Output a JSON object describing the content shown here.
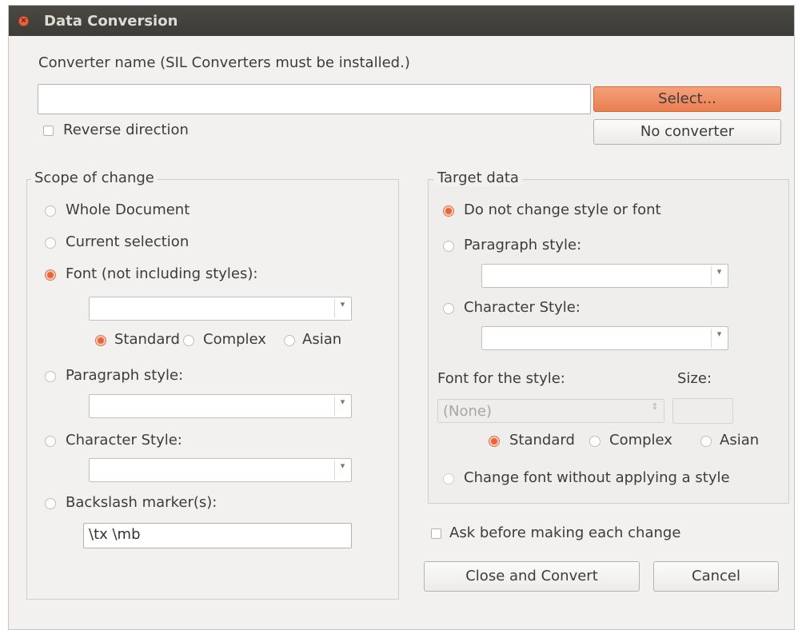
{
  "window": {
    "title": "Data Conversion"
  },
  "converter": {
    "label": "Converter name (SIL Converters must be installed.)",
    "name_value": "",
    "select_button": "Select...",
    "no_converter_button": "No converter",
    "reverse_direction": "Reverse direction"
  },
  "scope": {
    "title": "Scope of change",
    "whole_document": "Whole Document",
    "current_selection": "Current selection",
    "font": "Font (not including styles):",
    "font_value": "",
    "script_options": [
      "Standard",
      "Complex",
      "Asian"
    ],
    "paragraph_style": "Paragraph style:",
    "paragraph_value": "",
    "character_style": "Character Style:",
    "character_value": "",
    "backslash_markers": "Backslash marker(s):",
    "backslash_value": "\\tx \\mb"
  },
  "target": {
    "title": "Target data",
    "no_change": "Do not change style or font",
    "paragraph_style": "Paragraph style:",
    "character_style": "Character Style:",
    "font_for_style": "Font for the style:",
    "size_label": "Size:",
    "font_value": "(None)",
    "script_options": [
      "Standard",
      "Complex",
      "Asian"
    ],
    "change_font_without_style": "Change font without applying a style"
  },
  "footer": {
    "ask_before_change": "Ask before making each change",
    "close_and_convert": "Close and Convert",
    "cancel": "Cancel"
  },
  "colors": {
    "accent": "#e7643a",
    "titlebar": "#3c3b37",
    "window_bg": "#f2f1f0"
  }
}
